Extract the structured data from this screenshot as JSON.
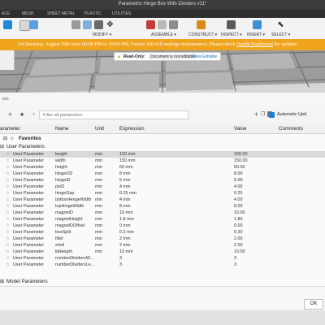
{
  "app": {
    "title": "Parametric Hinge Box With Dividers v11*"
  },
  "workspace_tabs": [
    "ACE",
    "MESH",
    "SHEET METAL",
    "PLASTIC",
    "UTILITIES"
  ],
  "toolbar": {
    "groups": [
      {
        "label": "",
        "icon": "sketch-icon",
        "color": "#1c8ad6",
        "active": true
      },
      {
        "label": "MODIFY ▾",
        "icon": "modify-icon",
        "color": "#8a8a8a"
      },
      {
        "label": "ASSEMBLE ▾",
        "icon": "assemble-icon",
        "color": "#c43b3b"
      },
      {
        "label": "CONSTRUCT ▾",
        "icon": "construct-icon",
        "color": "#d98a1a"
      },
      {
        "label": "INSPECT ▾",
        "icon": "inspect-icon",
        "color": "#5a5a5a"
      },
      {
        "label": "INSERT ▾",
        "icon": "insert-icon",
        "color": "#3c8fd6"
      },
      {
        "label": "SELECT ▾",
        "icon": "select-icon",
        "color": "#444444"
      }
    ]
  },
  "banner": {
    "text": "On Saturday, August 19th from 09:00 PM to 10:00 PM, Fusion 360 will undergo maintenance. Please check ",
    "link": "Health Dashboard",
    "tail": " for updates.",
    "color": "#f0a41e"
  },
  "readonly": {
    "label": "Read-Only:",
    "message": "Document is not editable",
    "action": "View Editable"
  },
  "dialog": {
    "title": "ers",
    "search_placeholder": "Filter all parameters",
    "auto_update_label": "Automatic Upd",
    "columns": [
      "arameter",
      "Name",
      "Unit",
      "Expression",
      "Value",
      "Comments"
    ],
    "favorites_label": "Favorites",
    "user_params_label": "User Parameters",
    "model_params_label": "Model Parameters",
    "ok_label": "OK",
    "rows": [
      {
        "type": "User Parameter",
        "name": "length",
        "unit": "mm",
        "expression": "150 mm",
        "value": "150.00"
      },
      {
        "type": "User Parameter",
        "name": "width",
        "unit": "mm",
        "expression": "150 mm",
        "value": "150.00"
      },
      {
        "type": "User Parameter",
        "name": "height",
        "unit": "mm",
        "expression": "60 mm",
        "value": "60.00"
      },
      {
        "type": "User Parameter",
        "name": "hingeOD",
        "unit": "mm",
        "expression": "8 mm",
        "value": "8.00"
      },
      {
        "type": "User Parameter",
        "name": "hingeID",
        "unit": "mm",
        "expression": "5 mm",
        "value": "5.00"
      },
      {
        "type": "User Parameter",
        "name": "pinD",
        "unit": "mm",
        "expression": "4 mm",
        "value": "4.00"
      },
      {
        "type": "User Parameter",
        "name": "hingeGap",
        "unit": "mm",
        "expression": "0.25 mm",
        "value": "0.25"
      },
      {
        "type": "User Parameter",
        "name": "bottomHingeWidth",
        "unit": "mm",
        "expression": "4 mm",
        "value": "4.00"
      },
      {
        "type": "User Parameter",
        "name": "topHingeWidth",
        "unit": "mm",
        "expression": "8 mm",
        "value": "8.00"
      },
      {
        "type": "User Parameter",
        "name": "magnetD",
        "unit": "mm",
        "expression": "10 mm",
        "value": "10.00"
      },
      {
        "type": "User Parameter",
        "name": "magnetHeight",
        "unit": "mm",
        "expression": "1.8 mm",
        "value": "1.80"
      },
      {
        "type": "User Parameter",
        "name": "magnetDOffset",
        "unit": "mm",
        "expression": "0 mm",
        "value": "0.00"
      },
      {
        "type": "User Parameter",
        "name": "boxSplit",
        "unit": "mm",
        "expression": "0.3 mm",
        "value": "0.30"
      },
      {
        "type": "User Parameter",
        "name": "fillet",
        "unit": "mm",
        "expression": "2 mm",
        "value": "2.00"
      },
      {
        "type": "User Parameter",
        "name": "shell",
        "unit": "mm",
        "expression": "2 mm",
        "value": "2.00"
      },
      {
        "type": "User Parameter",
        "name": "lidHeight",
        "unit": "mm",
        "expression": "10 mm",
        "value": "10.00"
      },
      {
        "type": "User Parameter",
        "name": "numberDividersW...",
        "unit": "",
        "expression": "3",
        "value": "3"
      },
      {
        "type": "User Parameter",
        "name": "numberDividersLe...",
        "unit": "",
        "expression": "3",
        "value": "3"
      }
    ]
  }
}
